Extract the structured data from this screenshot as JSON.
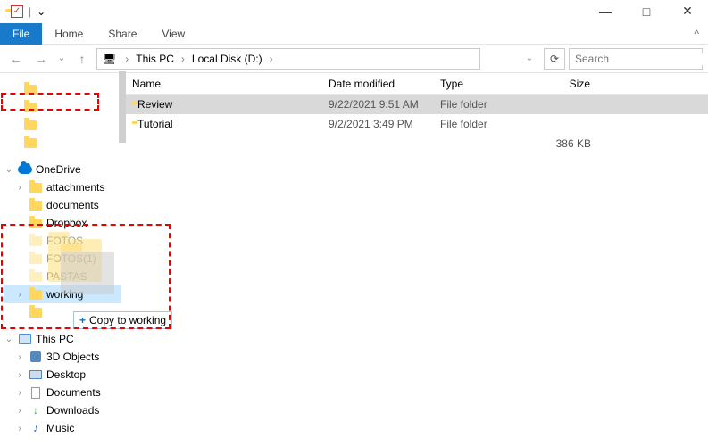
{
  "titlebar": {
    "dropdown": "⌄",
    "divider": "|"
  },
  "win": {
    "min": "—",
    "max": "□",
    "close": "✕"
  },
  "menubar": {
    "file": "File",
    "home": "Home",
    "share": "Share",
    "view": "View",
    "expand": "^"
  },
  "nav": {
    "back": "←",
    "forward": "→",
    "dropdown": "⌄",
    "up": "↑",
    "refresh": "⟳",
    "search_icon": "🔍"
  },
  "breadcrumb": {
    "seg1": "This PC",
    "seg2": "Local Disk (D:)",
    "chev": "›"
  },
  "search": {
    "placeholder": "Search"
  },
  "columns": {
    "name": "Name",
    "date": "Date modified",
    "type": "Type",
    "size": "Size"
  },
  "rows": [
    {
      "name": "Review",
      "date": "9/22/2021 9:51 AM",
      "type": "File folder",
      "size": ""
    },
    {
      "name": "Tutorial",
      "date": "9/2/2021 3:49 PM",
      "type": "File folder",
      "size": ""
    }
  ],
  "summary_size": "386 KB",
  "tree": {
    "onedrive": "OneDrive",
    "attachments": "attachments",
    "documents": "documents",
    "dropbox": "Dropbox",
    "fotos": "FOTOS",
    "fotos1": "FOTOS(1)",
    "pastas": "PASTAS",
    "working": "working",
    "thispc": "This PC",
    "obj3d": "3D Objects",
    "desktop": "Desktop",
    "docs": "Documents",
    "downloads": "Downloads",
    "music": "Music"
  },
  "drag": {
    "label": "Copy to working",
    "plus": "+"
  }
}
